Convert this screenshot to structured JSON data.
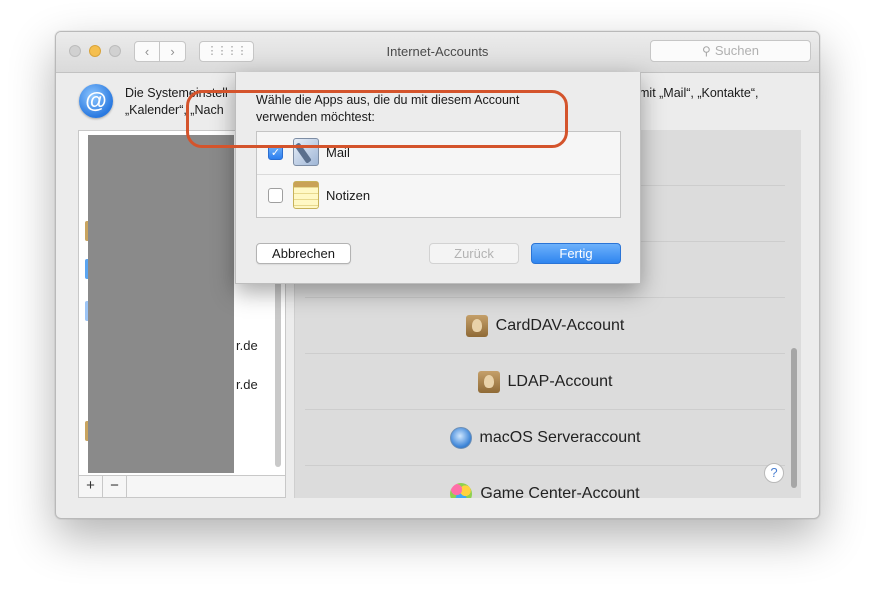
{
  "window": {
    "title": "Internet-Accounts",
    "search_placeholder": "Suchen",
    "nav_back": "‹",
    "nav_forward": "›",
    "grid_glyph": "⋮⋮⋮⋮"
  },
  "header": {
    "text_left_line1": "Die Systemeinstell",
    "text_left_line2": "„Kalender“, „Nach",
    "text_right_line1": "mit „Mail“, „Kontakte“,"
  },
  "account_list": {
    "partial_suffixes": [
      "r.de",
      "r.de"
    ],
    "add_label": "+",
    "remove_label": "−"
  },
  "providers": [
    {
      "label": "CardDAV-Account",
      "icon": "contacts-icon"
    },
    {
      "label": "LDAP-Account",
      "icon": "contacts-icon"
    },
    {
      "label": "macOS Serveraccount",
      "icon": "server-icon"
    },
    {
      "label": "Game Center-Account",
      "icon": "game-center-icon"
    }
  ],
  "help_label": "?",
  "sheet": {
    "prompt": "Wähle die Apps aus, die du mit diesem Account verwenden möchtest:",
    "apps": [
      {
        "label": "Mail",
        "checked": true,
        "icon": "mail-icon"
      },
      {
        "label": "Notizen",
        "checked": false,
        "icon": "notes-icon"
      }
    ],
    "checkmark": "✓",
    "buttons": {
      "cancel": "Abbrechen",
      "back": "Zurück",
      "done": "Fertig"
    }
  },
  "colors": {
    "accent": "#2f85ef",
    "highlight": "#d4542c"
  }
}
